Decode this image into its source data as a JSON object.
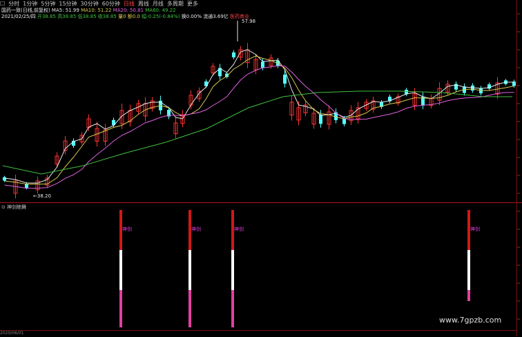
{
  "toolbar": {
    "icon_label": "☐",
    "tabs": [
      "分时",
      "1分钟",
      "5分钟",
      "15分钟",
      "30分钟",
      "60分钟",
      "日线",
      "周线",
      "月线",
      "多周期",
      "更多"
    ],
    "selected_index": 6
  },
  "info_line1": {
    "stock": "国药一致(日线,前复权)",
    "ma5": "MA5: 51.99",
    "ma10": "MA10: 51.22",
    "ma20": "MA20: 50.81",
    "ma60": "MA60: 49.22"
  },
  "info_line2": {
    "date": "2021/02/25/四",
    "open": "开38.85",
    "high": "高38.85",
    "low": "低38.85",
    "close": "收38.85",
    "volume": "量0",
    "amount": "额0.0",
    "change": "幅-0.25(-0.84%)",
    "turnover": "换0.00%",
    "float_cap": "流通3.69亿",
    "industry": "医药商业"
  },
  "annotations": {
    "high_label": "57.98",
    "low_label": "←38.20"
  },
  "subchart": {
    "title": "神剑绝舞",
    "signal_text": "神剑"
  },
  "bottom_axis": {
    "date_label": "2020/06/01"
  },
  "watermark": "www.7gpzb.com",
  "colors": {
    "up": "#ff3232",
    "down": "#54ffff",
    "ma5": "#e8e8e8",
    "ma10": "#d8c850",
    "ma20": "#e060e0",
    "ma60": "#40c040",
    "signal_red": "#d01818",
    "signal_white": "#ffffff",
    "signal_pink": "#e040a0"
  }
}
